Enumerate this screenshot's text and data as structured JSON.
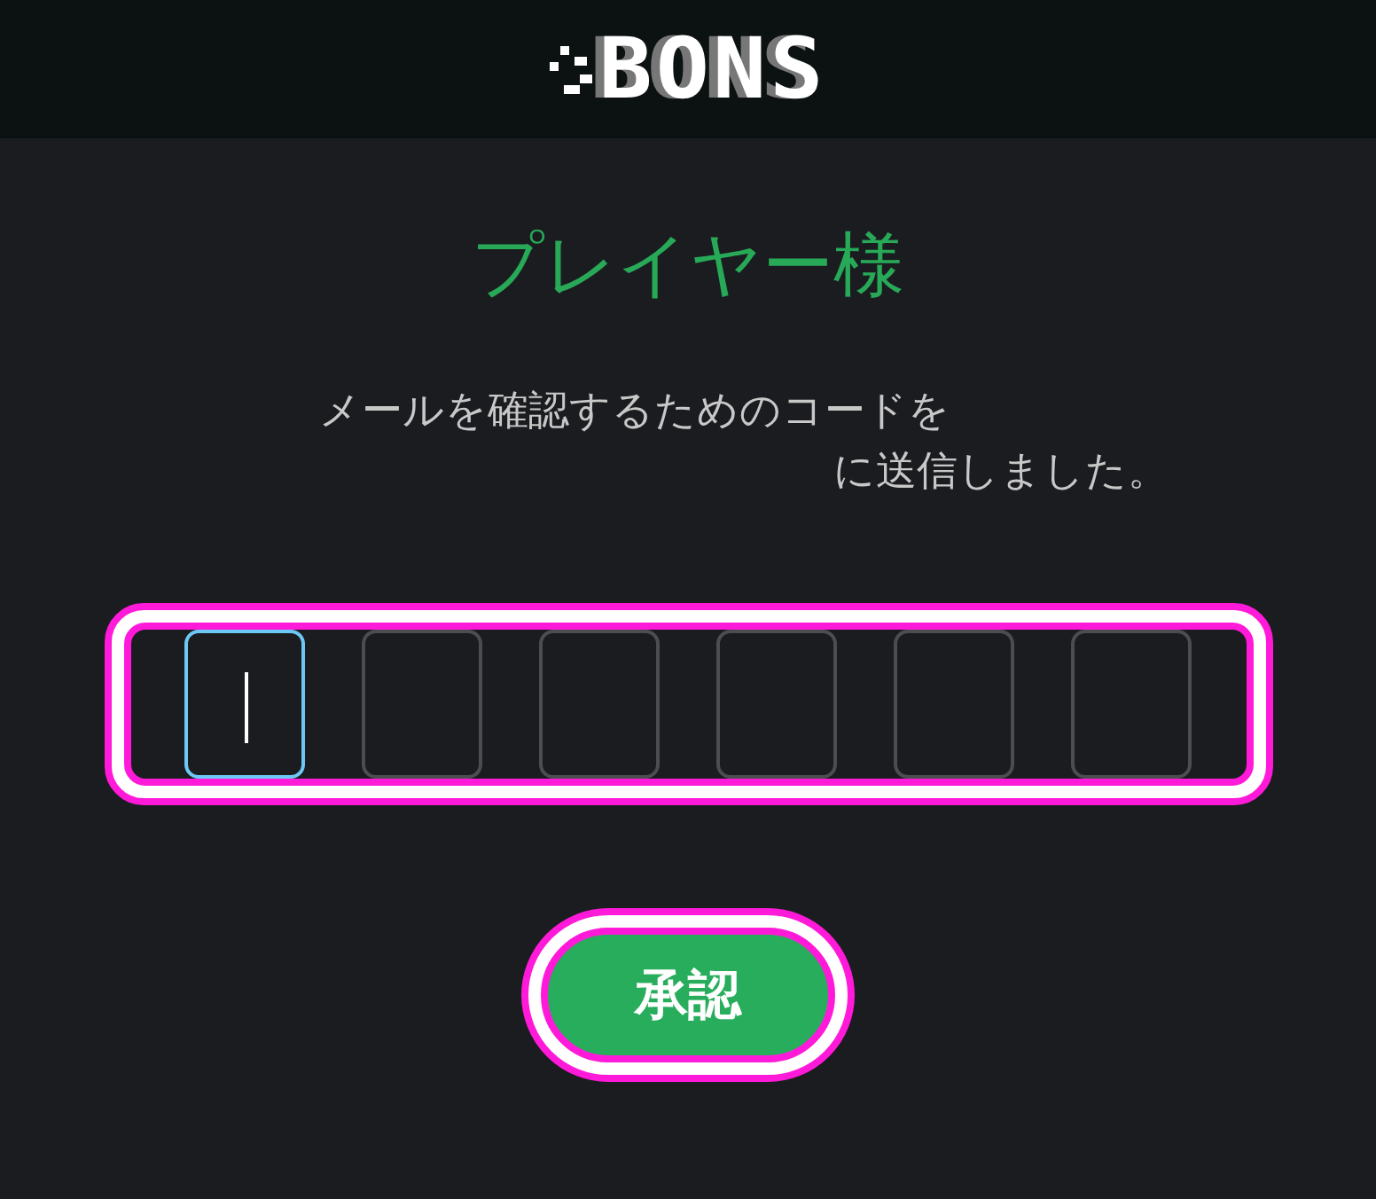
{
  "header": {
    "logo": "BONS"
  },
  "title": "プレイヤー様",
  "message_lines": [
    "メールを確認するためのコードを",
    "に送信しました。"
  ],
  "code_fields": [
    {
      "focused": true
    },
    {
      "focused": false
    },
    {
      "focused": false
    },
    {
      "focused": false
    },
    {
      "focused": false
    },
    {
      "focused": false
    }
  ],
  "submit_button": "承認"
}
